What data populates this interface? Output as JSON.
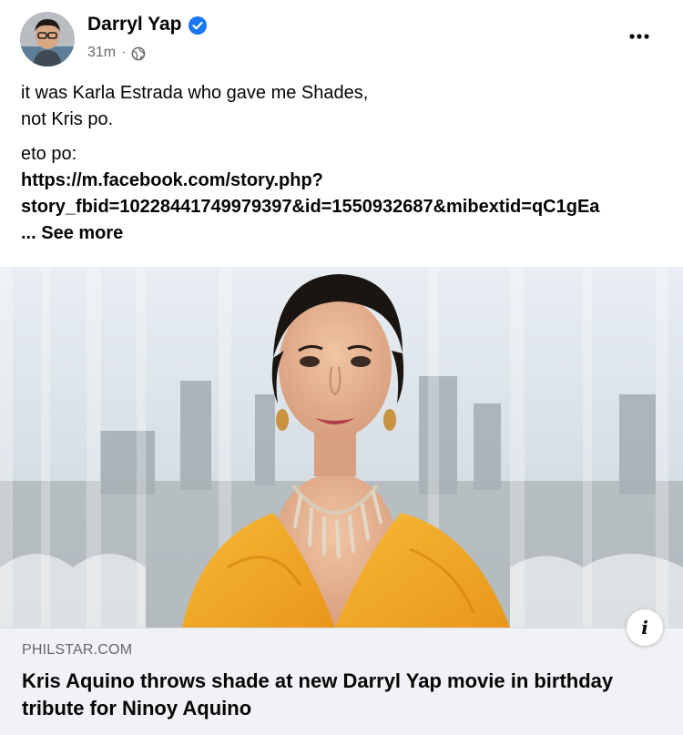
{
  "post": {
    "author": "Darryl Yap",
    "timestamp": "31m",
    "separator": "·",
    "audience_icon": "globe-icon",
    "more_icon": "more-horizontal-icon",
    "verified_icon": "verified-badge-icon",
    "text_line1": "it was Karla Estrada who gave me Shades,",
    "text_line2": "not Kris po.",
    "text_line3": "eto po:",
    "link_line1": "https://m.facebook.com/story.php?",
    "link_line2": "story_fbid=10228441749979397&id=1550932687&mibextid=qC1gEa",
    "see_more": "... See more"
  },
  "preview": {
    "domain": "PHILSTAR.COM",
    "headline": "Kris Aquino throws shade at new Darryl Yap movie in birthday tribute for Ninoy Aquino",
    "info_label": "i"
  },
  "colors": {
    "primary_text": "#050505",
    "secondary_text": "#65676b",
    "verified_blue": "#1877f2",
    "preview_bg": "#f0f2f5",
    "dress_yellow": "#f2a61c"
  }
}
